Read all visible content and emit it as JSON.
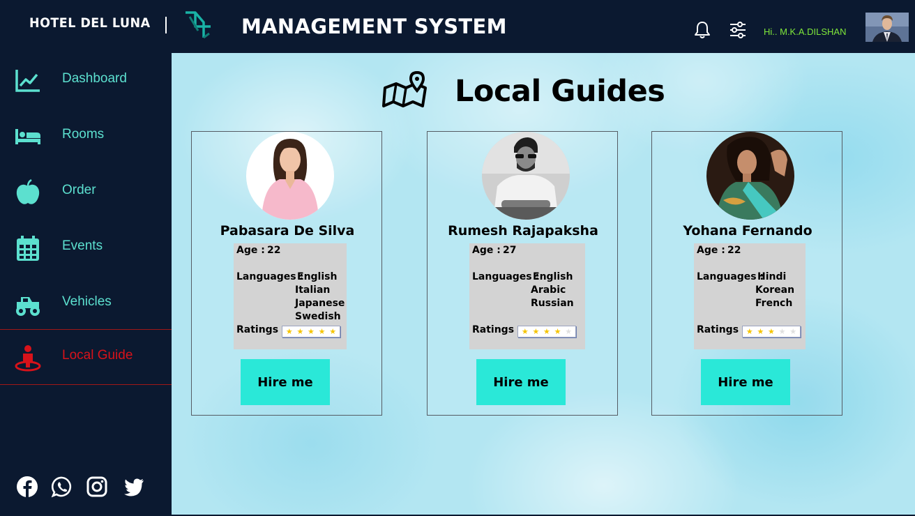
{
  "header": {
    "brand": "HOTEL DEL LUNA",
    "title": "MANAGEMENT SYSTEM",
    "greeting": "Hi.. M.K.A.DILSHAN"
  },
  "sidebar": {
    "items": [
      {
        "label": "Dashboard",
        "icon": "chart-line-icon"
      },
      {
        "label": "Rooms",
        "icon": "bed-icon"
      },
      {
        "label": "Order",
        "icon": "apple-icon"
      },
      {
        "label": "Events",
        "icon": "calendar-icon"
      },
      {
        "label": "Vehicles",
        "icon": "monster-truck-icon"
      },
      {
        "label": "Local Guide",
        "icon": "location-person-icon",
        "active": true
      }
    ],
    "social": [
      "facebook-icon",
      "whatsapp-icon",
      "instagram-icon",
      "twitter-icon"
    ]
  },
  "main": {
    "title": "Local Guides",
    "labels": {
      "age": "Age :",
      "languages": "Languages :",
      "ratings": "Ratings :",
      "hire": "Hire me"
    },
    "guides": [
      {
        "name": "Pabasara De Silva",
        "age": "22",
        "languages": [
          "English",
          "Italian",
          "Japanese",
          "Swedish"
        ],
        "rating": 5
      },
      {
        "name": "Rumesh Rajapaksha",
        "age": "27",
        "languages": [
          "English",
          "Arabic",
          "Russian"
        ],
        "rating": 4
      },
      {
        "name": "Yohana Fernando",
        "age": "22",
        "languages": [
          "Hindi",
          "Korean",
          "French"
        ],
        "rating": 3
      }
    ]
  },
  "colors": {
    "sidebar_bg": "#0b1930",
    "accent_teal": "#5ce0cf",
    "active_red": "#d8121a",
    "greeting_green": "#7fe83a",
    "button_teal": "#2ae8d8",
    "star_gold": "#f5c400"
  }
}
